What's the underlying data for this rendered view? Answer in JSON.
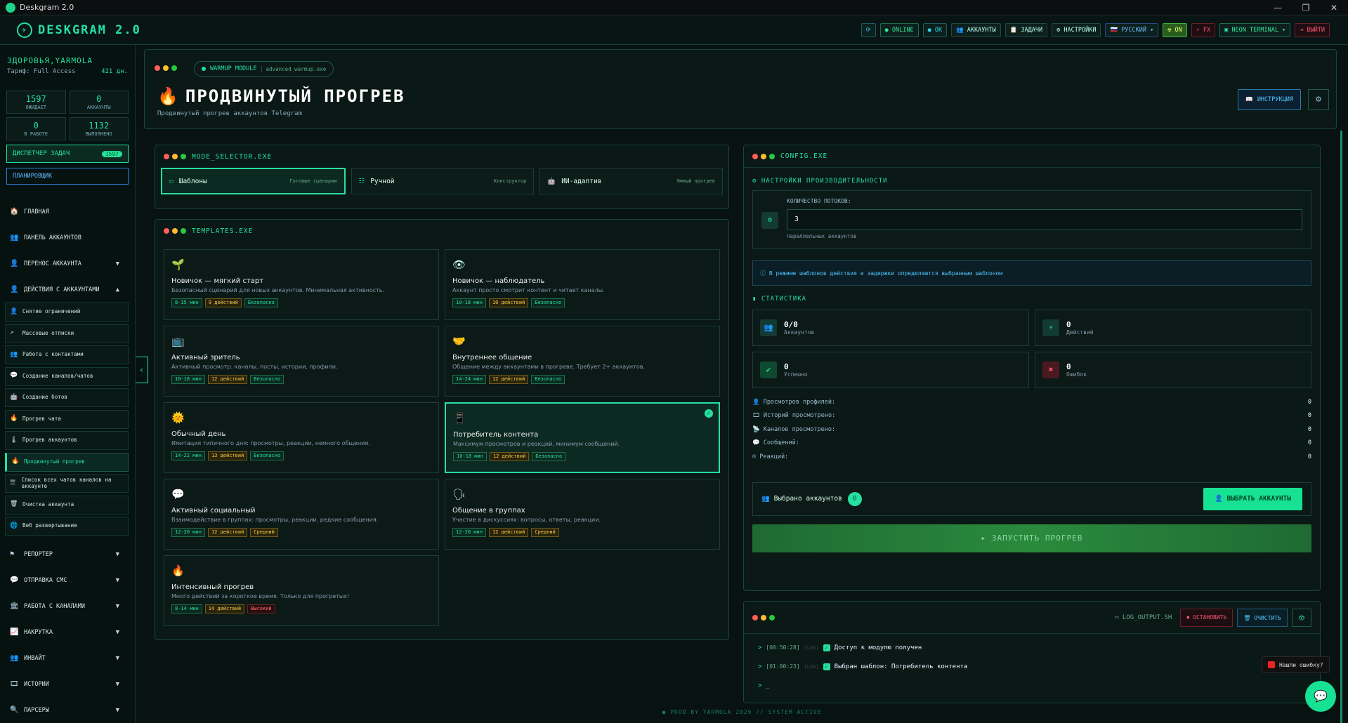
{
  "window": {
    "title": "Deskgram 2.0",
    "min": "—",
    "max": "❐",
    "close": "✕"
  },
  "header": {
    "logo": "DESKGRAM 2.0",
    "nav": [
      {
        "label": "⟳",
        "style": "cyan",
        "name": "refresh-button"
      },
      {
        "label": "● ONLINE",
        "style": "green",
        "name": "online-status"
      },
      {
        "label": "● OK",
        "style": "cyan",
        "name": "ok-status"
      },
      {
        "label": "👥 АККАУНТЫ",
        "style": "",
        "name": "accounts-button"
      },
      {
        "label": "📋 ЗАДАЧИ",
        "style": "",
        "name": "tasks-button"
      },
      {
        "label": "⚙ НАСТРОЙКИ",
        "style": "",
        "name": "settings-button"
      },
      {
        "label": "🇷🇺 РУССКИЙ ▾",
        "style": "blue",
        "name": "language-select"
      },
      {
        "label": "☢ ON",
        "style": "yellow",
        "name": "radiation-toggle"
      },
      {
        "label": "⚡ FX",
        "style": "red",
        "name": "fx-toggle"
      },
      {
        "label": "▣ NEON TERMINAL ▾",
        "style": "green",
        "name": "theme-select"
      },
      {
        "label": "⇥ ВЫЙТИ",
        "style": "red",
        "name": "logout-button"
      }
    ]
  },
  "sidebar": {
    "user": "ЗДОРОВЬЯ,YARMOLA",
    "tarif_label": "Тариф: Full Access",
    "tarif_days": "421 дн.",
    "stats": [
      {
        "v": "1597",
        "l": "ОЖИДАЕТ"
      },
      {
        "v": "0",
        "l": "АККАУНТЫ"
      },
      {
        "v": "0",
        "l": "В РАБОТЕ"
      },
      {
        "v": "1132",
        "l": "ВЫПОЛНЕНО"
      }
    ],
    "dispatch": "ДИСПЕТЧЕР ЗАДАЧ",
    "dispatch_count": "1597",
    "planner": "ПЛАНИРОВЩИК",
    "menu_top": [
      {
        "ic": "🏠",
        "label": "ГЛАВНАЯ"
      },
      {
        "ic": "👥",
        "label": "ПАНЕЛЬ АККАУНТОВ"
      },
      {
        "ic": "👤",
        "label": "ПЕРЕНОС АККАУНТА",
        "arr": "▼"
      },
      {
        "ic": "👤",
        "label": "ДЕЙСТВИЯ С АККАУНТАМИ",
        "arr": "▲"
      }
    ],
    "submenu": [
      {
        "ic": "👤",
        "label": "Снятие ограничений"
      },
      {
        "ic": "↗",
        "label": "Массовые отписки"
      },
      {
        "ic": "👥",
        "label": "Работа с контактами"
      },
      {
        "ic": "💬",
        "label": "Создание каналов/чатов"
      },
      {
        "ic": "🤖",
        "label": "Создание ботов"
      },
      {
        "ic": "🔥",
        "label": "Прогрев чата"
      },
      {
        "ic": "🌡",
        "label": "Прогрев аккаунтов"
      },
      {
        "ic": "🔥",
        "label": "Продвинутый прогрев",
        "active": true
      },
      {
        "ic": "☰",
        "label": "Список всех чатов каналов на аккаунте"
      },
      {
        "ic": "🗑",
        "label": "Очистка аккаунта"
      },
      {
        "ic": "🌐",
        "label": "Веб развертывание"
      }
    ],
    "menu_bottom": [
      {
        "ic": "⚑",
        "label": "РЕПОРТЕР"
      },
      {
        "ic": "💬",
        "label": "ОТПРАВКА СМС"
      },
      {
        "ic": "🏛",
        "label": "РАБОТА С КАНАЛАМИ"
      },
      {
        "ic": "📈",
        "label": "НАКРУТКА"
      },
      {
        "ic": "👥",
        "label": "ИНВАЙТ"
      },
      {
        "ic": "🎞",
        "label": "ИСТОРИИ"
      },
      {
        "ic": "🔍",
        "label": "ПАРСЕРЫ"
      }
    ]
  },
  "module": {
    "pill": "WARMUP MODULE",
    "file": "advanced_warmup.exe",
    "title": "ПРОДВИНУТЫЙ ПРОГРЕВ",
    "subtitle": "Продвинутый прогрев аккаунтов Telegram",
    "instr": "ИНСТРУКЦИЯ"
  },
  "mode_selector": {
    "title": "MODE_SELECTOR.EXE",
    "modes": [
      {
        "ic": "▭",
        "label": "Шаблоны",
        "desc": "Готовые сценарии",
        "sel": true
      },
      {
        "ic": "☷",
        "label": "Ручной",
        "desc": "Конструктор"
      },
      {
        "ic": "🤖",
        "label": "ИИ-адаптив",
        "desc": "Умный прогрев"
      }
    ]
  },
  "templates": {
    "title": "TEMPLATES.EXE",
    "items": [
      {
        "emo": "🌱",
        "t": "Новичок — мягкий старт",
        "d": "Безопасный сценарий для новых аккаунтов. Минимальная активность.",
        "time": "8-15 мин",
        "act": "9 действий",
        "risk": "Безопасно",
        "rc": "g1"
      },
      {
        "emo": "👁",
        "t": "Новичок — наблюдатель",
        "d": "Аккаунт просто смотрит контент и читает каналы.",
        "time": "10-18 мин",
        "act": "10 действий",
        "risk": "Безопасно",
        "rc": "g1"
      },
      {
        "emo": "📺",
        "t": "Активный зритель",
        "d": "Активный просмотр: каналы, посты, истории, профили.",
        "time": "10-18 мин",
        "act": "12 действий",
        "risk": "Безопасно",
        "rc": "g1"
      },
      {
        "emo": "🤝",
        "t": "Внутреннее общение",
        "d": "Общение между аккаунтами в прогреве. Требует 2+ аккаунтов.",
        "time": "14-24 мин",
        "act": "12 действий",
        "risk": "Безопасно",
        "rc": "g1"
      },
      {
        "emo": "🌞",
        "t": "Обычный день",
        "d": "Имитация типичного дня: просмотры, реакции, немного общения.",
        "time": "14-22 мин",
        "act": "13 действий",
        "risk": "Безопасно",
        "rc": "g1"
      },
      {
        "emo": "📱",
        "t": "Потребитель контента",
        "d": "Максимум просмотров и реакций, минимум сообщений.",
        "time": "10-18 мин",
        "act": "12 действий",
        "risk": "Безопасно",
        "rc": "g1",
        "sel": true
      },
      {
        "emo": "💬",
        "t": "Активный социальный",
        "d": "Взаимодействие в группах: просмотры, реакции, редкие сообщения.",
        "time": "12-20 мин",
        "act": "12 действий",
        "risk": "Средний",
        "rc": "y1"
      },
      {
        "emo": "🗣",
        "t": "Общение в группах",
        "d": "Участие в дискуссиях: вопросы, ответы, реакции.",
        "time": "12-20 мин",
        "act": "12 действий",
        "risk": "Средний",
        "rc": "y1"
      },
      {
        "emo": "🔥",
        "t": "Интенсивный прогрев",
        "d": "Много действий за короткое время. Только для прогретых!",
        "time": "8-14 мин",
        "act": "14 действий",
        "risk": "Высокий",
        "rc": "r1"
      }
    ]
  },
  "config": {
    "title": "CONFIG.EXE",
    "perf": "НАСТРОЙКИ ПРОИЗВОДИТЕЛЬНОСТИ",
    "threads_label": "КОЛИЧЕСТВО ПОТОКОВ:",
    "threads_value": "3",
    "threads_hint": "параллельных аккаунтов",
    "info": "ⓘ В режиме шаблонов действия и задержки определяются выбранным шаблоном",
    "stats_title": "СТАТИСТИКА",
    "boxes": [
      {
        "ic": "👥",
        "v": "0/0",
        "l": "Аккаунтов",
        "bg": "#133a33",
        "c": "#25e0a0"
      },
      {
        "ic": "⚡",
        "v": "0",
        "l": "Действий",
        "bg": "#133a33",
        "c": "#25e0a0"
      },
      {
        "ic": "✔",
        "v": "0",
        "l": "Успешно",
        "bg": "#0f4a30",
        "c": "#25e0a0"
      },
      {
        "ic": "✖",
        "v": "0",
        "l": "Ошибок",
        "bg": "#4a1a20",
        "c": "#ff5470"
      }
    ],
    "rows": [
      {
        "l": "👤 Просмотров профилей:",
        "v": "0"
      },
      {
        "l": "🎞 Историй просмотрено:",
        "v": "0"
      },
      {
        "l": "📡 Каналов просмотрено:",
        "v": "0"
      },
      {
        "l": "💬 Сообщений:",
        "v": "0"
      },
      {
        "l": "☺ Реакций:",
        "v": "0"
      }
    ],
    "selected_label": "Выбрано аккаунтов",
    "selected_count": "0",
    "select_btn": "👤 ВЫБРАТЬ АККАУНТЫ",
    "run": "▸ ЗАПУСТИТЬ ПРОГРЕВ"
  },
  "log": {
    "file": "LOG_OUTPUT.SH",
    "stop": "⏹ ОСТАНОВИТЬ",
    "clear": "🗑 ОЧИСТИТЬ",
    "eye": "👁",
    "lines": [
      {
        "ts": "[00:50:28]",
        "tag": "[LOG]",
        "text": "Доступ к модулю получен"
      },
      {
        "ts": "[01:00:23]",
        "tag": "[LOG]",
        "text": "Выбран шаблон: Потребитель контента"
      }
    ],
    "prompt": "> _"
  },
  "footer": "● PROD BY YARMOLA 2026   // SYSTEM ACTIVE",
  "help": "Нашли ошибку?"
}
